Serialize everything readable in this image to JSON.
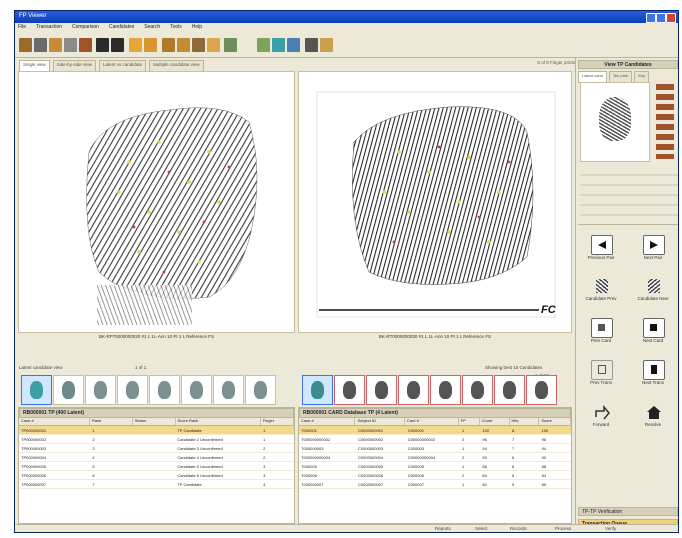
{
  "app": {
    "title": "FP Viewer"
  },
  "menu": [
    "File",
    "Transaction",
    "Comparison",
    "Candidates",
    "Search",
    "Tools",
    "Help"
  ],
  "tabs": [
    "Single view",
    "Side-by-side view",
    "Latent vs candidate",
    "Multiple candidate view"
  ],
  "pager": "0 of 8 Finger prints",
  "left_caption": "BK-RP70000000030 #1 L 1L-Ann 10 Pt 1 L Reference FS",
  "right_caption": "BK-RT0000000030 #1 L 1L-Ann 10 Pt 1 L Reference FS",
  "fc_label": "FC",
  "strip": {
    "left": "Latent candidate view",
    "left_count": "1 of 1",
    "right": "Showing best 10 Candidates",
    "right_count": "1 of 10"
  },
  "left_panel": {
    "title": "RB000001 TP (400 Latent)",
    "columns": [
      "Case #",
      "Rank",
      "Status",
      "Score Rank",
      "Finger"
    ],
    "rows": [
      [
        "TP000000001",
        "1",
        "",
        "TP Candidate",
        "1"
      ],
      [
        "TP000000002",
        "2",
        "",
        "Candidate 2 Unconfirmed",
        "1"
      ],
      [
        "TP000000003",
        "3",
        "",
        "Candidate 3 Unconfirmed",
        "2"
      ],
      [
        "TP000000004",
        "4",
        "",
        "Candidate 4 Unconfirmed",
        "2"
      ],
      [
        "TP000000005",
        "5",
        "",
        "Candidate 5 Unconfirmed",
        "3"
      ],
      [
        "TP000000006",
        "6",
        "",
        "Candidate 6 Unconfirmed",
        "3"
      ],
      [
        "TP000000007",
        "7",
        "",
        "TP Candidate",
        "4"
      ]
    ]
  },
  "right_panel": {
    "title": "RB000001 CARD Database TP (4 Latent)",
    "columns": [
      "Case #",
      "Subject ID",
      "Card #",
      "FP",
      "Count",
      "Hits",
      "Score"
    ],
    "rows": [
      [
        "T000001",
        "C0000000001",
        "C000001",
        "1",
        "100",
        "8",
        "100"
      ],
      [
        "T000000000002",
        "C0000000002",
        "C00000000002",
        "2",
        "96",
        "7",
        "96"
      ],
      [
        "T000000003",
        "C0000000003",
        "C000003",
        "1",
        "94",
        "7",
        "94"
      ],
      [
        "T000000000004",
        "C0000000004",
        "C00000000004",
        "2",
        "90",
        "6",
        "90"
      ],
      [
        "T000005",
        "C0000000005",
        "C000005",
        "1",
        "88",
        "6",
        "88"
      ],
      [
        "T000006",
        "C0000000006",
        "C000006",
        "2",
        "84",
        "5",
        "84"
      ],
      [
        "T000000007",
        "C0000000007",
        "C000007",
        "1",
        "80",
        "5",
        "80"
      ]
    ]
  },
  "right_sidebar": {
    "title": "View TP Candidates",
    "tabs": [
      "Latent cand",
      "Ten print",
      "Key"
    ],
    "nav": [
      {
        "label": "Previous Pair",
        "icon": "arrow-left-icon"
      },
      {
        "label": "Next Pair",
        "icon": "arrow-right-icon"
      },
      {
        "label": "Candidate Prev",
        "icon": "fingerprint-icon"
      },
      {
        "label": "Candidate Next",
        "icon": "fingerprint-icon"
      },
      {
        "label": "Prev Card",
        "icon": "card-prev-icon"
      },
      {
        "label": "Next Card",
        "icon": "card-next-icon"
      },
      {
        "label": "Prev Trans",
        "icon": "trans-prev-icon"
      },
      {
        "label": "Next Trans",
        "icon": "trans-next-icon"
      },
      {
        "label": "Forward",
        "icon": "forward-icon"
      },
      {
        "label": "Resolve",
        "icon": "house-icon"
      }
    ],
    "footer1": "TP-TP Verification",
    "footer2": "Transaction Queue"
  },
  "status": {
    "left": "",
    "items": [
      "Reports",
      "Select",
      "Records",
      "Process",
      "Verify"
    ]
  }
}
